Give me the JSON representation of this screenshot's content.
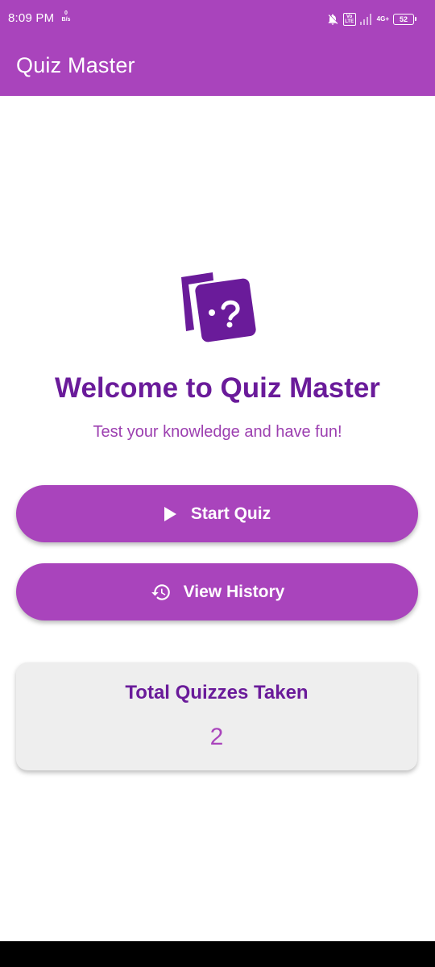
{
  "status_bar": {
    "time": "8:09 PM",
    "speed_value": "0",
    "speed_unit": "B/s",
    "volte_label": "Vo LTE",
    "network_label": "4G+",
    "battery_level": "52",
    "icons": [
      "mute-bell-icon",
      "volte-icon",
      "signal-icon",
      "battery-icon"
    ]
  },
  "app_bar": {
    "title": "Quiz Master",
    "color": "#a944bc"
  },
  "hero": {
    "icon": "quiz-cards-icon",
    "heading": "Welcome to Quiz Master",
    "subtitle": "Test your knowledge and have fun!"
  },
  "actions": {
    "start_label": "Start Quiz",
    "start_icon": "play-icon",
    "history_label": "View History",
    "history_icon": "history-icon"
  },
  "stats": {
    "title": "Total Quizzes Taken",
    "value": "2"
  },
  "colors": {
    "primary": "#a944bc",
    "heading": "#6a1b9a",
    "card_bg": "#eeeeee"
  }
}
